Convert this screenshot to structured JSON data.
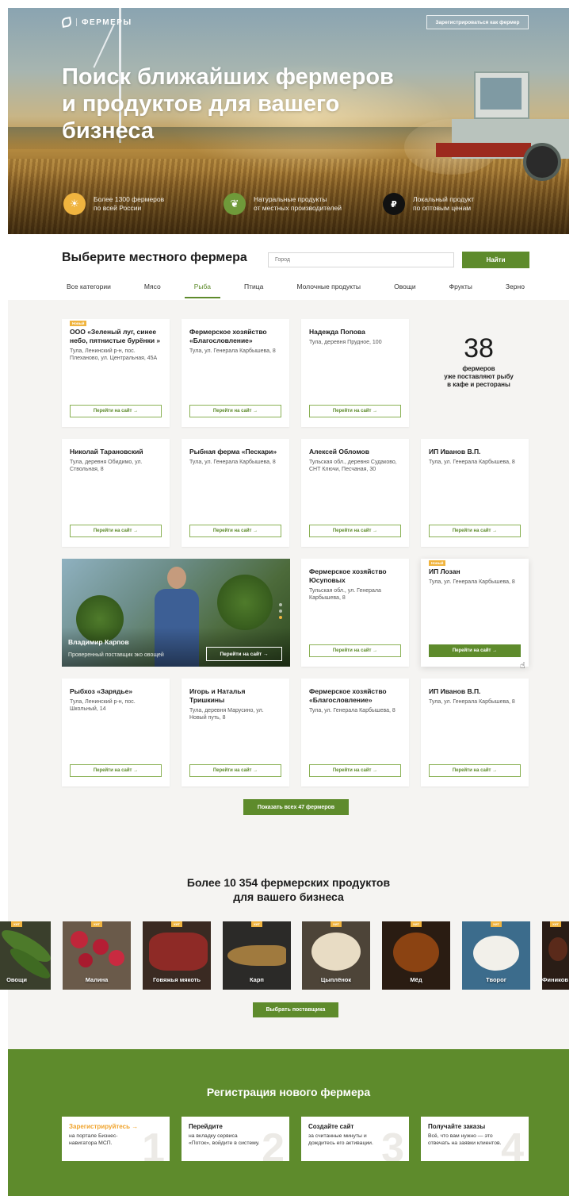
{
  "header": {
    "logo_text": "ФЕРМЕРЫ",
    "register_button": "Зарегистрироваться как фермер",
    "title": "Поиск ближайших фермеров и продуктов для вашего бизнеса"
  },
  "features": [
    {
      "icon": "sun-icon",
      "text": "Более 1300 фермеров\nпо всей России",
      "color": "#f0b43f"
    },
    {
      "icon": "sprout-icon",
      "text": "Натуральные продукты\nот местных производителей",
      "color": "#6f9a3a"
    },
    {
      "icon": "ruble-icon",
      "text": "Локальный продукт\nпо оптовым ценам",
      "color": "#111111"
    }
  ],
  "selector": {
    "title": "Выберите местного фермера",
    "city_placeholder": "Город",
    "find_button": "Найти"
  },
  "categories": [
    {
      "label": "Все категории",
      "active": false
    },
    {
      "label": "Мясо",
      "active": false
    },
    {
      "label": "Рыба",
      "active": true
    },
    {
      "label": "Птица",
      "active": false
    },
    {
      "label": "Молочные продукты",
      "active": false
    },
    {
      "label": "Овощи",
      "active": false
    },
    {
      "label": "Фрукты",
      "active": false
    },
    {
      "label": "Зерно",
      "active": false
    }
  ],
  "go_label": "Перейти на сайт →",
  "new_badge": "Новый",
  "farmers": [
    {
      "name": "ООО «Зеленый луг, синее небо, пятнистые бурёнки »",
      "address": "Тула, Ленинский р-н, пос. Плеханово, ул. Центральная, 45А",
      "badge": true
    },
    {
      "name": "Фермерское хозяйство «Благословление»",
      "address": "Тула, ул. Генерала Карбышева, 8"
    },
    {
      "name": "Надежда Попова",
      "address": "Тула, деревня Прудное, 100"
    },
    {
      "name": "Николай Тарановский",
      "address": "Тула, деревня Обидимо, ул. Ствольная, 8"
    },
    {
      "name": "Рыбная ферма «Пескари»",
      "address": "Тула, ул. Генерала Карбышева, 8"
    },
    {
      "name": "Алексей Обломов",
      "address": "Тульская обл., деревня Судаково, СНТ Ключи, Песчаная, 30"
    },
    {
      "name": "ИП Иванов В.П.",
      "address": "Тула, ул. Генерала Карбышева, 8"
    },
    {
      "name": "Фермерское хозяйство Юсуповых",
      "address": "Тульская обл., ул. Генерала Карбышева, 8"
    },
    {
      "name": "ИП Лозан",
      "address": "Тула, ул. Генерала Карбышева, 8",
      "badge": true,
      "filled": true
    },
    {
      "name": "Рыбхоз «Зарядье»",
      "address": "Тула, Ленинский р-н, пос. Школьный, 14"
    },
    {
      "name": "Игорь и Наталья Тришкины",
      "address": "Тула, деревня Марусино, ул. Новый путь, 8"
    },
    {
      "name": "Фермерское хозяйство «Благословление»",
      "address": "Тула, ул. Генерала Карбышева, 8"
    },
    {
      "name": "ИП Иванов В.П.",
      "address": "Тула, ул. Генерала Карбышева, 8"
    }
  ],
  "stat": {
    "number": "38",
    "label": "фермеров\nуже поставляют рыбу\nв кафе и рестораны"
  },
  "promo": {
    "name": "Владимир Карпов",
    "description": "Проверенный поставщик эко овощей",
    "button": "Перейти на сайт →"
  },
  "show_all_button": "Показать всех 47 фермеров",
  "products_section": {
    "title": "Более 10 354 фермерских продуктов\nдля вашего бизнеса",
    "tag": "ХИТ",
    "items": [
      "Овощи",
      "Малина",
      "Говяжья мякоть",
      "Карп",
      "Цыплёнок",
      "Мёд",
      "Творог",
      "Фиников"
    ],
    "choose_button": "Выбрать поставщика"
  },
  "registration": {
    "title": "Регистрация нового фермера",
    "steps": [
      {
        "num": "1",
        "title": "Зарегистрируйтесь →",
        "desc": "на портале Бизнес-\nнавигатора МСП."
      },
      {
        "num": "2",
        "title": "Перейдите",
        "desc": "на вкладку сервиса\n«Поток», войдите в систему."
      },
      {
        "num": "3",
        "title": "Создайте сайт",
        "desc": "за считанные минуты и\nдождитесь его активации."
      },
      {
        "num": "4",
        "title": "Получайте заказы",
        "desc": "Всё, что вам нужно — это\nотвечать на заявки клиентов."
      }
    ]
  },
  "colors": {
    "accent": "#5e8b2c",
    "badge": "#f0b43f"
  }
}
